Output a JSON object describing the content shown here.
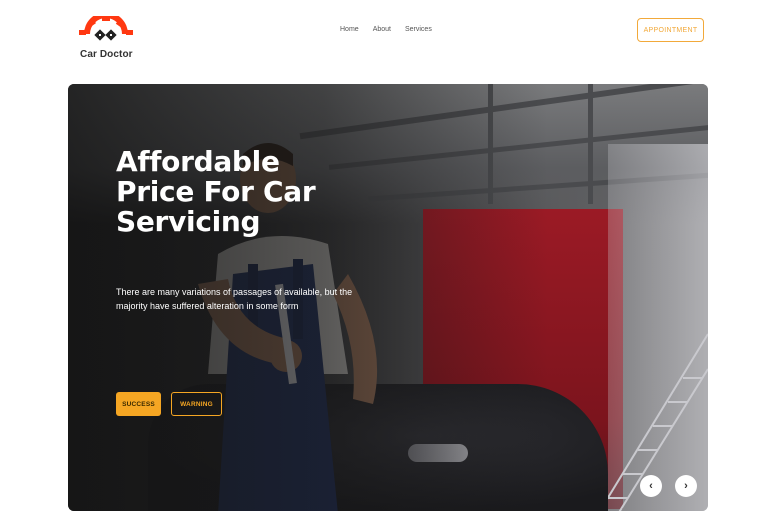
{
  "brand": {
    "name": "Car Doctor",
    "logo_icon": "gear-with-wrenches-icon",
    "accent_color": "#ff3811"
  },
  "nav": {
    "items": [
      {
        "label": "Home"
      },
      {
        "label": "About"
      },
      {
        "label": "Services"
      }
    ],
    "appointment_label": "APPOINTMENT"
  },
  "hero": {
    "title": "Affordable Price For Car Servicing",
    "description": "There are many variations of passages of available, but the majority have suffered alteration in some form",
    "buttons": {
      "success_label": "SUCCESS",
      "warning_label": "WARNING"
    },
    "prev_icon": "chevron-left-icon",
    "next_icon": "chevron-right-icon",
    "prev_glyph": "‹",
    "next_glyph": "›"
  },
  "colors": {
    "accent_orange": "#f5a623",
    "outline_orange": "#f2a93a",
    "hero_red": "#9b1a25"
  }
}
